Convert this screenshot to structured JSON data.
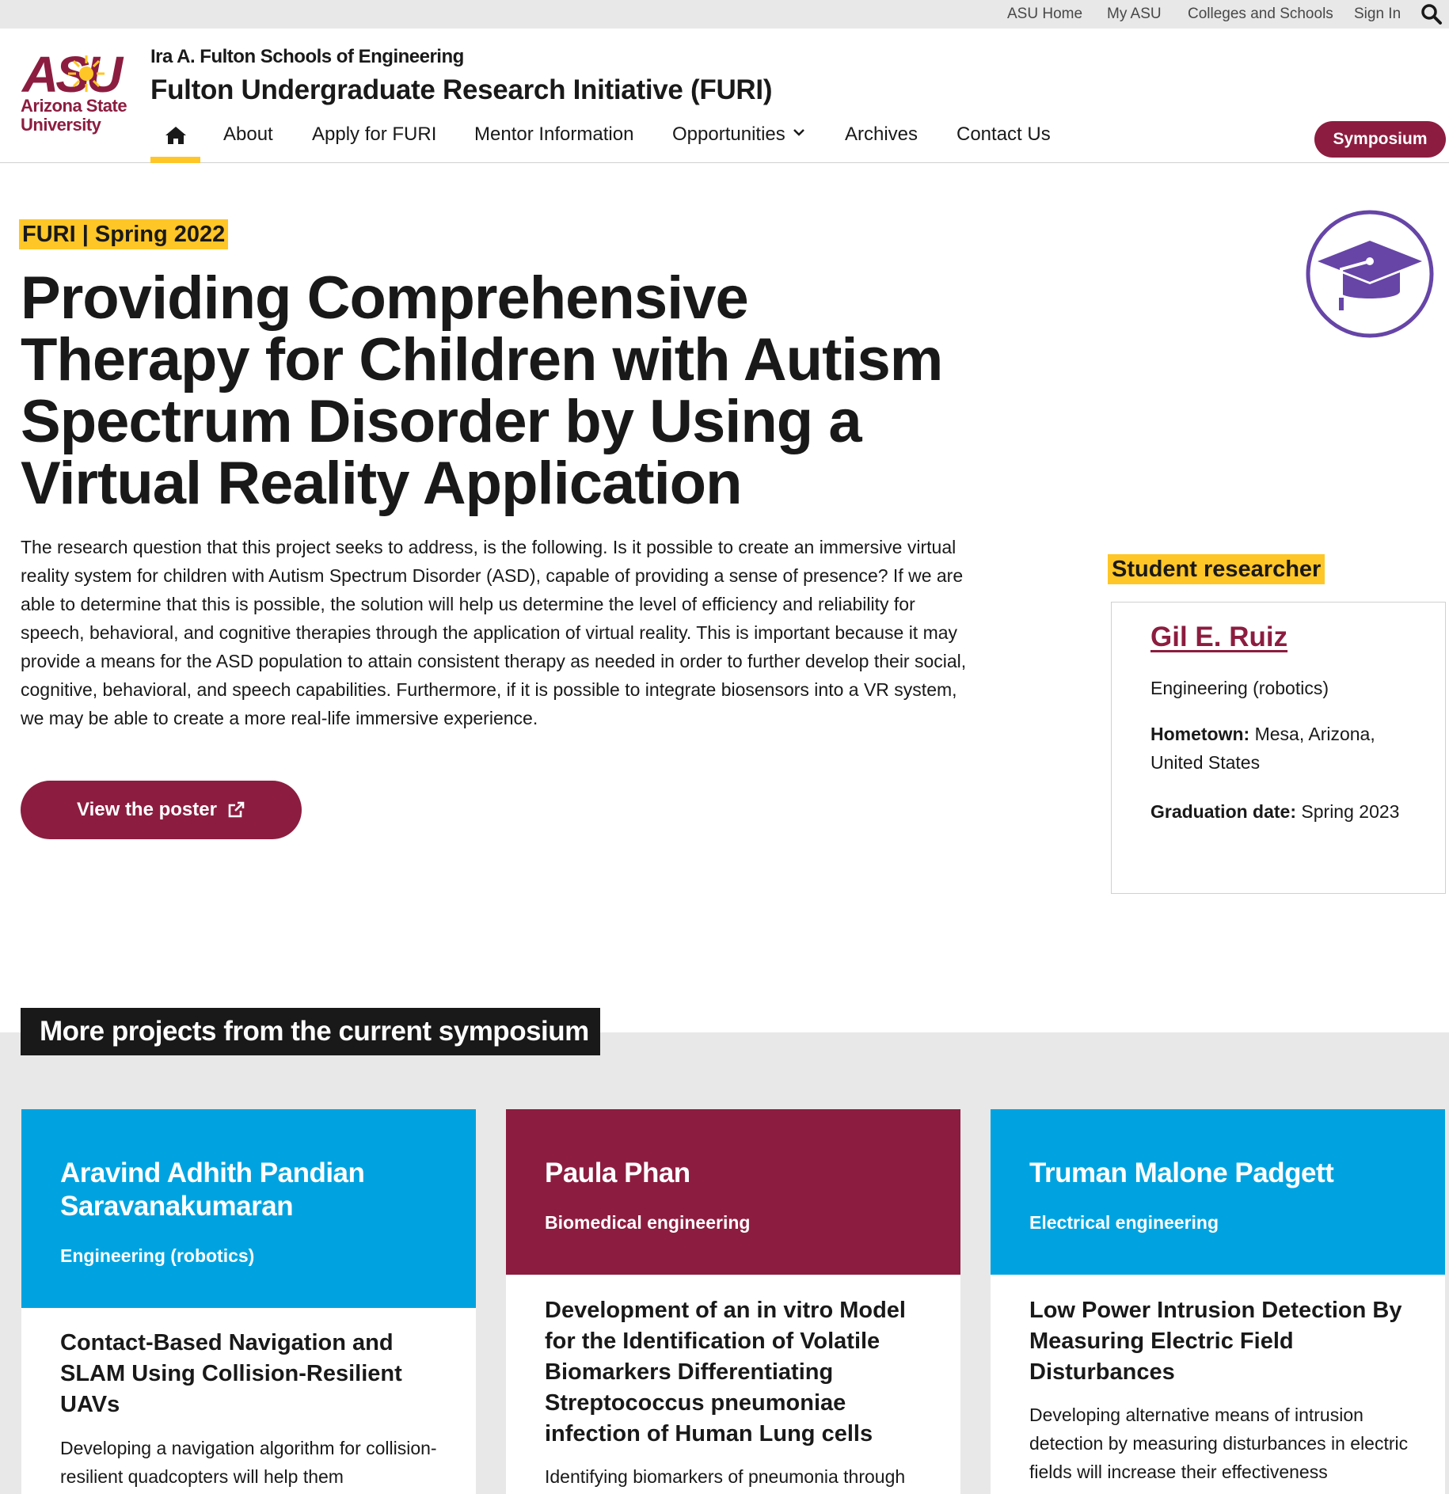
{
  "utility": {
    "links": [
      "ASU Home",
      "My ASU",
      "Colleges and Schools",
      "Sign In"
    ]
  },
  "header": {
    "logo_mark": "ASU",
    "logo_line1": "Arizona State",
    "logo_line2": "University",
    "unit_name": "Ira A. Fulton Schools of Engineering",
    "site_title": "Fulton Undergraduate Research Initiative (FURI)",
    "nav": [
      "About",
      "Apply for FURI",
      "Mentor Information",
      "Opportunities",
      "Archives",
      "Contact Us"
    ],
    "cta_label": "Symposium"
  },
  "hero": {
    "eyebrow": "FURI | Spring 2022",
    "title": "Providing Comprehensive Therapy for Children with Autism Spectrum Disorder by Using a Virtual Reality Application",
    "abstract": "The research question that this project seeks to address, is the following. Is it possible to create an immersive virtual reality system for children with Autism Spectrum Disorder (ASD), capable of providing a sense of presence? If we are able to determine that this is possible, the solution will help us determine the level of efficiency and reliability for speech, behavioral, and cognitive therapies through the application of virtual reality. This is important because it may provide a means for the ASD population to attain consistent therapy as needed in order to further develop their social, cognitive, behavioral, and speech capabilities. Furthermore, if it is possible to integrate biosensors into a VR system, we may be able to create a more real-life immersive experience.",
    "poster_button": "View the poster"
  },
  "student": {
    "label": "Student researcher",
    "name": "Gil E. Ruiz",
    "major": "Engineering (robotics)",
    "hometown_label": "Hometown:",
    "hometown": "Mesa, Arizona, United States",
    "graduation_label": "Graduation date:",
    "graduation": "Spring 2023"
  },
  "more": {
    "heading": "More projects from the current symposium",
    "cards": [
      {
        "student": "Aravind Adhith Pandian Saravanakumaran",
        "major": "Engineering (robotics)",
        "title": "Contact-Based Navigation and SLAM Using Collision-Resilient UAVs",
        "desc": "Developing a navigation algorithm for collision-resilient quadcopters will help them",
        "color": "#00a3e0"
      },
      {
        "student": "Paula Phan",
        "major": "Biomedical engineering",
        "title": "Development of an in vitro Model for the Identification of Volatile Biomarkers Differentiating Streptococcus pneumoniae infection of Human Lung cells",
        "desc": "Identifying biomarkers of pneumonia through",
        "color": "#8c1d40"
      },
      {
        "student": "Truman Malone Padgett",
        "major": "Electrical engineering",
        "title": "Low Power Intrusion Detection By Measuring Electric Field Disturbances",
        "desc": "Developing alternative means of intrusion detection by measuring disturbances in electric fields will increase their effectiveness",
        "color": "#00a3e0"
      }
    ]
  },
  "colors": {
    "maroon": "#8c1d40",
    "gold": "#ffc627",
    "blue": "#00a3e0",
    "grad_purple": "#6645a7"
  }
}
